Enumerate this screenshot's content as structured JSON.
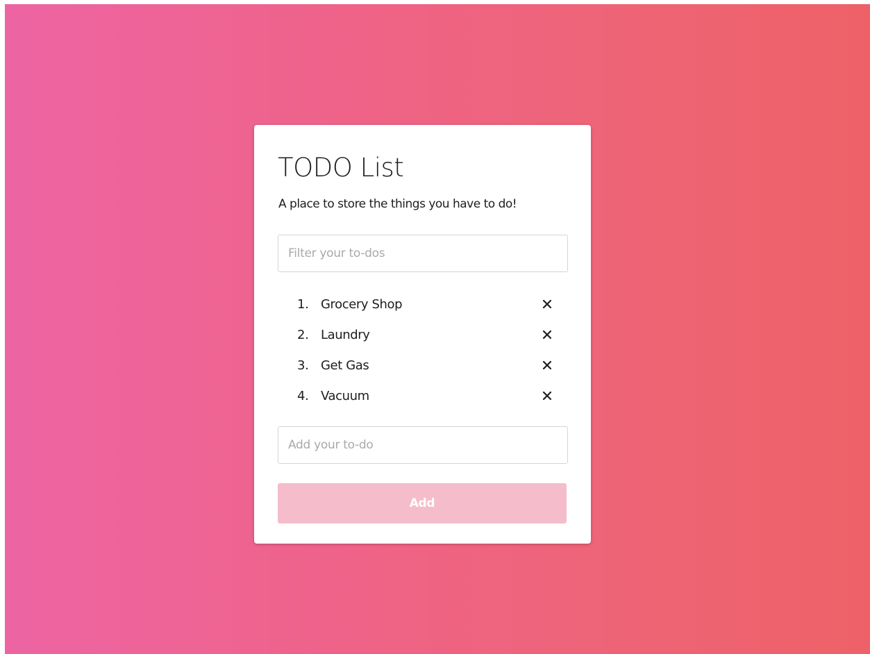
{
  "app": {
    "title": "TODO List",
    "subtitle": "A place to store the things you have to do!"
  },
  "filter": {
    "value": "",
    "placeholder": "Filter your to-dos"
  },
  "todos": [
    {
      "number": "1.",
      "text": "Grocery Shop"
    },
    {
      "number": "2.",
      "text": "Laundry"
    },
    {
      "number": "3.",
      "text": "Get Gas"
    },
    {
      "number": "4.",
      "text": "Vacuum"
    }
  ],
  "remove_icon": "close-icon",
  "new_todo": {
    "value": "",
    "placeholder": "Add your to-do"
  },
  "add_button": {
    "label": "Add"
  },
  "colors": {
    "background_start": "#ed64a3",
    "background_end": "#ee6168",
    "button_background": "#f5bdcb",
    "text": "#1d1d1d"
  }
}
